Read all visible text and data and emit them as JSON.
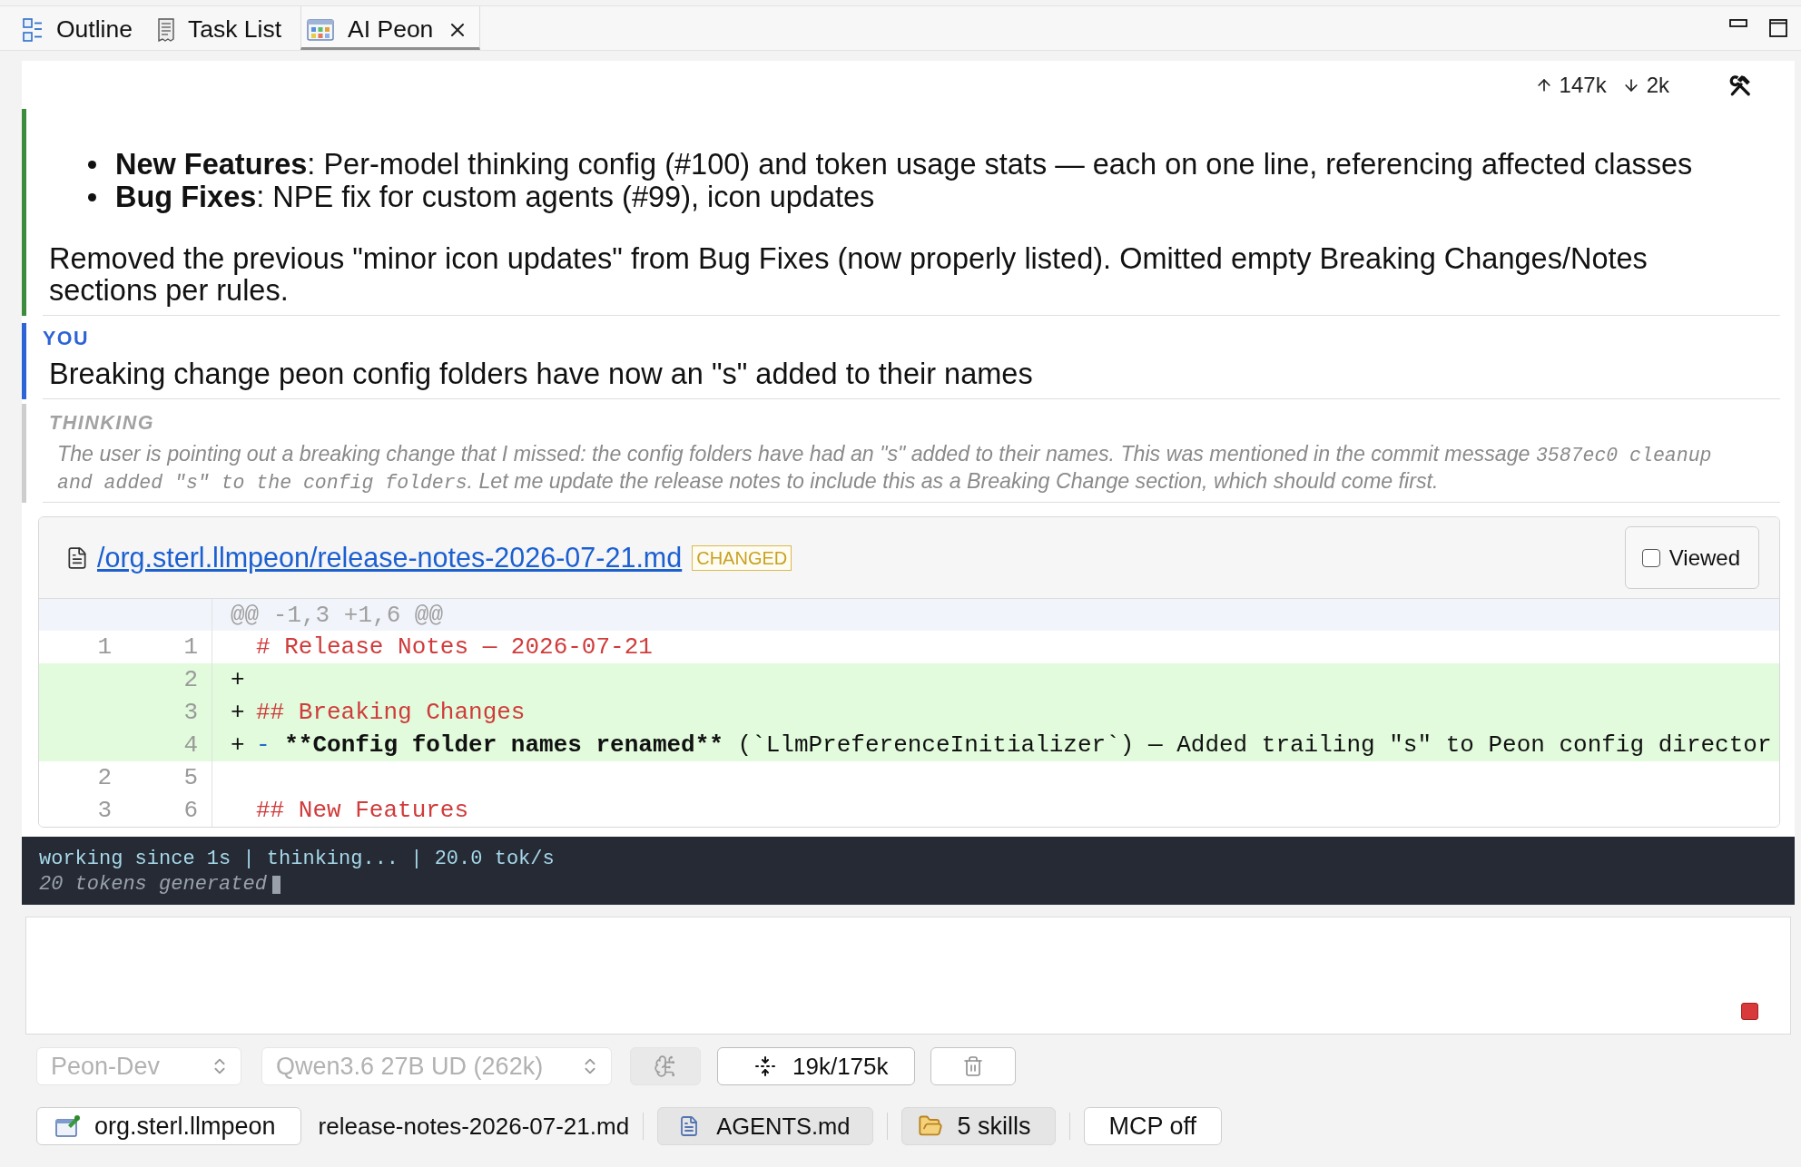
{
  "tabs": [
    {
      "kind": "outline",
      "label": "Outline",
      "selected": false
    },
    {
      "kind": "tasks",
      "label": "Task List",
      "selected": false
    },
    {
      "kind": "peon",
      "label": "AI Peon",
      "selected": true
    }
  ],
  "usage": {
    "sent": "147k",
    "received": "2k"
  },
  "messages": [
    {
      "kind": "assistant",
      "bullets": [
        "**New Features**: Per-model thinking config (#100) and token usage stats — each on one line, referencing affected classes",
        "**Bug Fixes**: NPE fix for custom agents (#99), icon updates"
      ],
      "paragraphs": [
        "Removed the previous \"minor icon updates\" from Bug Fixes (now properly listed). Omitted empty Breaking Changes/Notes sections per rules."
      ]
    },
    {
      "kind": "user",
      "role_label": "YOU",
      "text": "Breaking change peon config folders have now an \"s\" added to their names"
    },
    {
      "kind": "thinking",
      "role_label": "THINKING",
      "segments": [
        {
          "kind": "text",
          "text": "The user is pointing out a breaking change that I missed: the config folders have had an \"s\" added to their names. This was mentioned in the commit message "
        },
        {
          "kind": "code",
          "text": "3587ec0 cleanup and added \"s\" to the config folders"
        },
        {
          "kind": "text",
          "text": ". Let me update the release notes to include this as a Breaking Change section, which should come first."
        }
      ]
    }
  ],
  "diff": {
    "path": "/org.sterl.llmpeon/release-notes-2026-07-21.md",
    "status": "CHANGED",
    "viewed_label": "Viewed",
    "viewed": false,
    "hunk": "@@ -1,3 +1,6 @@",
    "lines": [
      {
        "kind": "context",
        "old": "1",
        "new": "1",
        "segments": [
          {
            "kind": "heading",
            "text": "# Release Notes — 2026-07-21"
          }
        ]
      },
      {
        "kind": "added",
        "new": "2",
        "sign": "+"
      },
      {
        "kind": "added",
        "new": "3",
        "sign": "+",
        "segments": [
          {
            "kind": "heading",
            "text": "## Breaking Changes"
          }
        ]
      },
      {
        "kind": "added",
        "new": "4",
        "sign": "+",
        "segments": [
          {
            "kind": "marker",
            "text": "- "
          },
          {
            "kind": "strong",
            "text": "**Config folder names renamed**"
          },
          {
            "kind": "plain",
            "text": " (`LlmPreferenceInitializer`) — Added trailing \"s\" to Peon config director"
          }
        ]
      },
      {
        "kind": "context",
        "old": "2",
        "new": "5"
      },
      {
        "kind": "context",
        "old": "3",
        "new": "6",
        "segments": [
          {
            "kind": "heading",
            "text": "## New Features"
          }
        ]
      }
    ]
  },
  "status": {
    "activity": "working since 1s | thinking... | 20.0 tok/s",
    "tokens": "20 tokens generated"
  },
  "toolbar": {
    "agent": {
      "value": "Peon-Dev",
      "disabled": true
    },
    "model": {
      "value": "Qwen3.6 27B UD (262k)",
      "disabled": true
    },
    "thinking_button": {
      "disabled": true
    },
    "compact_button": {
      "label": "19k/175k"
    }
  },
  "context": {
    "project": "org.sterl.llmpeon",
    "file": "release-notes-2026-07-21.md",
    "toggles": [
      {
        "kind": "agents",
        "label": "AGENTS.md",
        "on": true
      },
      {
        "kind": "skills",
        "label": "5 skills",
        "on": true
      },
      {
        "kind": "mcp",
        "label": "MCP off",
        "on": false
      }
    ]
  }
}
